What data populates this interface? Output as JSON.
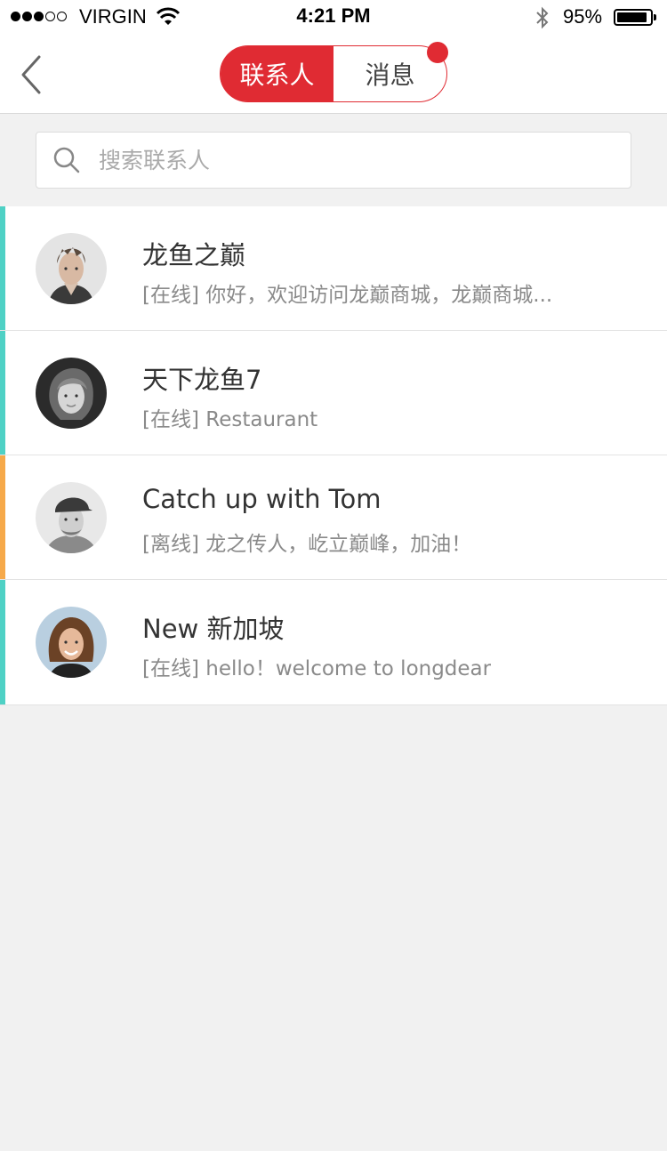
{
  "status_bar": {
    "carrier": "VIRGIN",
    "time": "4:21 PM",
    "battery_percent": "95%",
    "signal_bars_filled": 3,
    "signal_bars_total": 5
  },
  "nav": {
    "tabs": [
      {
        "label": "联系人",
        "active": true
      },
      {
        "label": "消息",
        "active": false,
        "has_badge": true
      }
    ],
    "accent_color": "#e02b33"
  },
  "search": {
    "placeholder": "搜索联系人",
    "value": ""
  },
  "contacts": [
    {
      "name": "龙鱼之巅",
      "message": "[在线] 你好，欢迎访问龙巅商城，龙巅商城...",
      "status_color": "#4fd1c5",
      "avatar": "man-spiky-hair-avatar"
    },
    {
      "name": "天下龙鱼7",
      "message": "[在线] Restaurant",
      "status_color": "#4fd1c5",
      "avatar": "woman-blonde-avatar"
    },
    {
      "name": "Catch up with Tom",
      "message": "[离线] 龙之传人，屹立巅峰，加油！",
      "status_color": "#f6a94a",
      "avatar": "man-cap-avatar"
    },
    {
      "name": "New 新加坡",
      "message": "[在线] hello！welcome to longdear",
      "status_color": "#4fd1c5",
      "avatar": "woman-smiling-avatar"
    }
  ]
}
